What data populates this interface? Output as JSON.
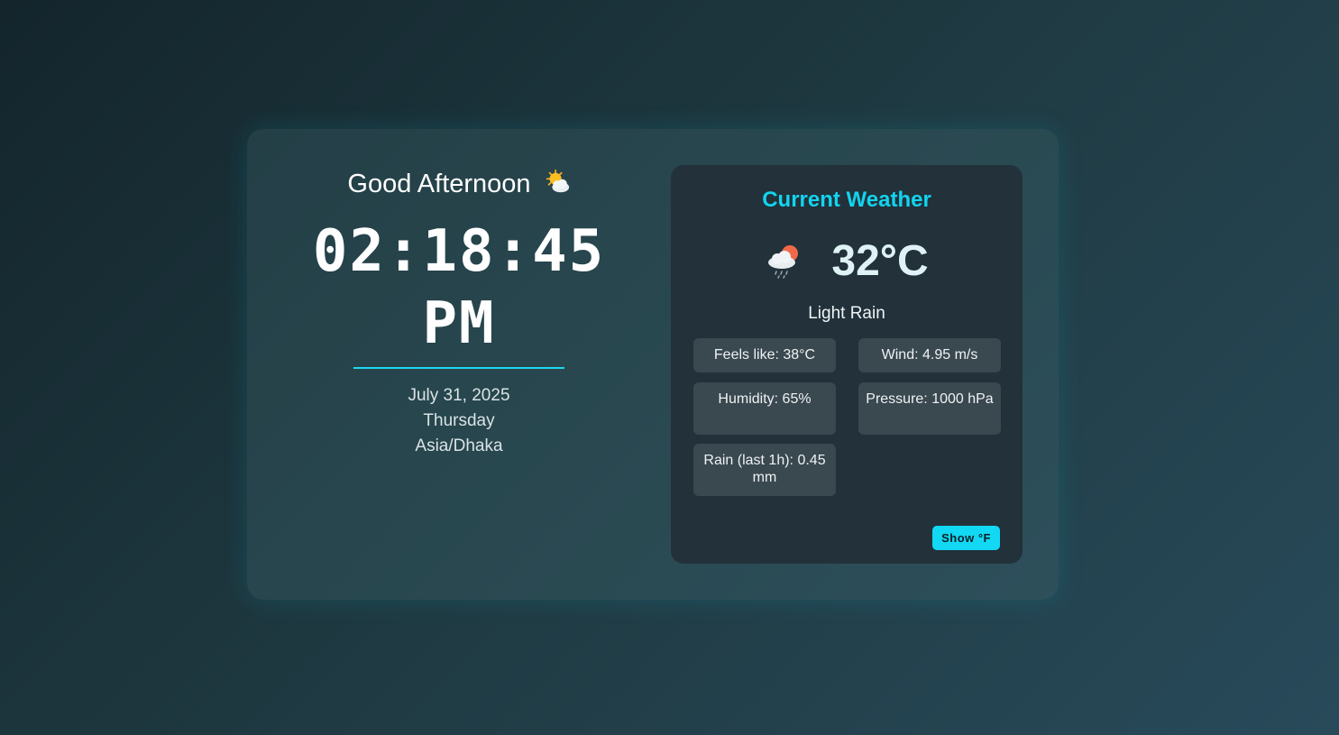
{
  "clock_panel": {
    "greeting": "Good Afternoon",
    "greeting_icon": "sun-behind-cloud-icon",
    "time": "02:18:45",
    "period": "PM",
    "date": "July 31, 2025",
    "weekday": "Thursday",
    "timezone": "Asia/Dhaka"
  },
  "weather_panel": {
    "title": "Current Weather",
    "icon": "rain-cloud-sun-icon",
    "temperature": "32°C",
    "description": "Light Rain",
    "stats": {
      "feels_like": "Feels like: 38°C",
      "wind": "Wind: 4.95 m/s",
      "humidity": "Humidity: 65%",
      "pressure": "Pressure: 1000 hPa",
      "rain": "Rain (last 1h): 0.45 mm"
    },
    "toggle_label": "Show °F"
  },
  "colors": {
    "accent": "#12d4ef",
    "panel_bg": "#22313a",
    "stat_bg": "#3a4850"
  }
}
